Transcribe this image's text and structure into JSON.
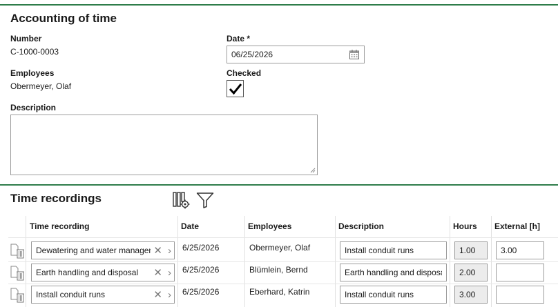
{
  "header": {
    "title": "Accounting of time"
  },
  "form": {
    "number_label": "Number",
    "number_value": "C-1000-0003",
    "date_label": "Date *",
    "date_value": "06/25/2026",
    "employees_label": "Employees",
    "employees_value": "Obermeyer, Olaf",
    "checked_label": "Checked",
    "checked": true,
    "description_label": "Description",
    "description_value": ""
  },
  "recordings": {
    "title": "Time recordings",
    "toolbar_icons": [
      "column-settings-icon",
      "filter-icon"
    ],
    "columns": {
      "time_recording": "Time recording",
      "date": "Date",
      "employees": "Employees",
      "description": "Description",
      "hours": "Hours",
      "external": "External [h]"
    },
    "rows": [
      {
        "time_recording": "Dewatering and water management",
        "date": "6/25/2026",
        "employees": "Obermeyer, Olaf",
        "description": "Install conduit runs",
        "hours": "1.00",
        "external": "3.00"
      },
      {
        "time_recording": "Earth handling and disposal",
        "date": "6/25/2026",
        "employees": "Blümlein, Bernd",
        "description": "Earth handling and disposal",
        "hours": "2.00",
        "external": ""
      },
      {
        "time_recording": "Install conduit runs",
        "date": "6/25/2026",
        "employees": "Eberhard, Katrin",
        "description": "Install conduit runs",
        "hours": "3.00",
        "external": ""
      }
    ]
  }
}
